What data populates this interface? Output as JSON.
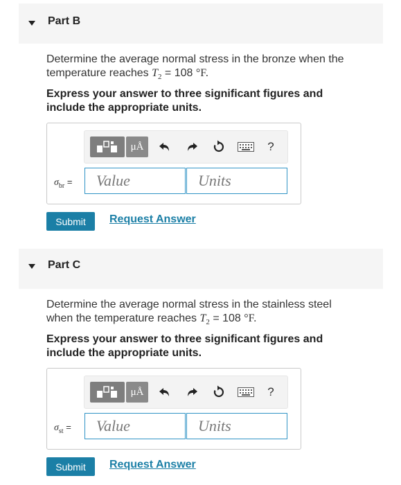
{
  "parts": [
    {
      "title": "Part B",
      "question_line1": "Determine the average normal stress in the bronze when the",
      "question_line2_prefix": "temperature reaches ",
      "temp_symbol": "T",
      "temp_subscript": "2",
      "temp_eq": " = 108 ",
      "temp_unit": "°F.",
      "instruction_line1": "Express your answer to three significant figures and",
      "instruction_line2": "include the appropriate units.",
      "sigma_symbol": "σ",
      "sigma_subscript": "br",
      "equals": " =",
      "value_placeholder": "Value",
      "units_placeholder": "Units",
      "mu_label": "μÅ",
      "help_label": "?",
      "submit_label": "Submit",
      "request_label": "Request Answer"
    },
    {
      "title": "Part C",
      "question_line1": "Determine the average normal stress in the stainless steel",
      "question_line2_prefix": "when the temperature reaches ",
      "temp_symbol": "T",
      "temp_subscript": "2",
      "temp_eq": " = 108 ",
      "temp_unit": "°F.",
      "instruction_line1": "Express your answer to three significant figures and",
      "instruction_line2": "include the appropriate units.",
      "sigma_symbol": "σ",
      "sigma_subscript": "st",
      "equals": " =",
      "value_placeholder": "Value",
      "units_placeholder": "Units",
      "mu_label": "μÅ",
      "help_label": "?",
      "submit_label": "Submit",
      "request_label": "Request Answer"
    }
  ],
  "colors": {
    "accent": "#1b7fa6",
    "input_border": "#2f93c5",
    "header_bg": "#f5f5f5"
  }
}
